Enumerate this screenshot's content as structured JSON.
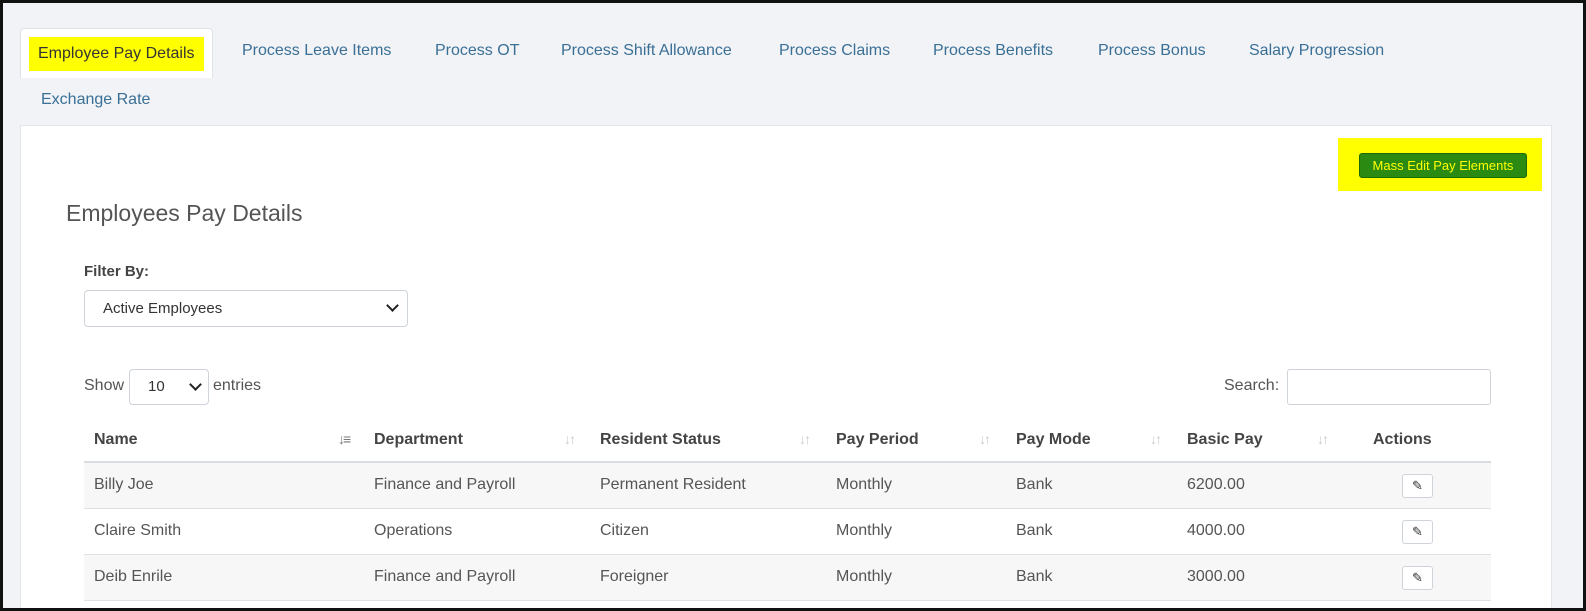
{
  "tabs": [
    {
      "label": "Employee Pay Details",
      "active": true
    },
    {
      "label": "Process Leave Items"
    },
    {
      "label": "Process OT"
    },
    {
      "label": "Process Shift Allowance"
    },
    {
      "label": "Process Claims"
    },
    {
      "label": "Process Benefits"
    },
    {
      "label": "Process Bonus"
    },
    {
      "label": "Salary Progression"
    },
    {
      "label": "Exchange Rate"
    }
  ],
  "toolbar": {
    "mass_edit_label": "Mass Edit Pay Elements"
  },
  "page": {
    "title": "Employees Pay Details"
  },
  "filter": {
    "label": "Filter By:",
    "value": "Active Employees"
  },
  "entries": {
    "show_label": "Show",
    "value": "10",
    "suffix": "entries"
  },
  "search": {
    "label": "Search:",
    "value": ""
  },
  "table": {
    "columns": [
      "Name",
      "Department",
      "Resident Status",
      "Pay Period",
      "Pay Mode",
      "Basic Pay",
      "Actions"
    ],
    "rows": [
      {
        "name": "Billy Joe",
        "department": "Finance and Payroll",
        "resident_status": "Permanent Resident",
        "pay_period": "Monthly",
        "pay_mode": "Bank",
        "basic_pay": "6200.00"
      },
      {
        "name": "Claire Smith",
        "department": "Operations",
        "resident_status": "Citizen",
        "pay_period": "Monthly",
        "pay_mode": "Bank",
        "basic_pay": "4000.00"
      },
      {
        "name": "Deib Enrile",
        "department": "Finance and Payroll",
        "resident_status": "Foreigner",
        "pay_period": "Monthly",
        "pay_mode": "Bank",
        "basic_pay": "3000.00"
      }
    ]
  },
  "icons": {
    "edit": "pencil-icon",
    "sort": "sort-icon",
    "dropdown": "chevron-down-icon"
  },
  "colors": {
    "highlight": "#ffff00",
    "primary_button": "#2a8a12",
    "link": "#3a6f96"
  }
}
